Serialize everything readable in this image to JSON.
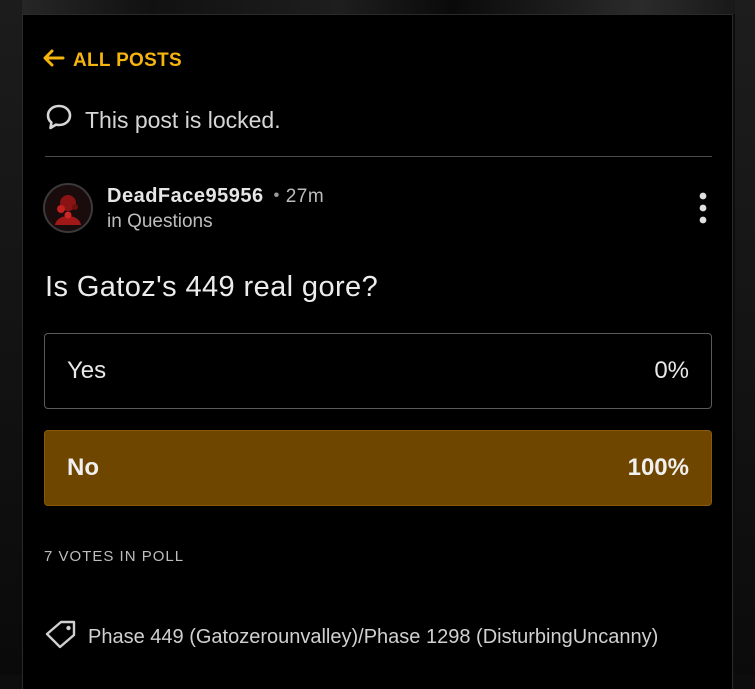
{
  "nav": {
    "back_label": "ALL POSTS"
  },
  "post": {
    "locked_text": "This post is locked.",
    "author": "DeadFace95956",
    "time": "27m",
    "category": "in Questions",
    "question": "Is Gatoz's 449 real gore?"
  },
  "poll": {
    "options": [
      {
        "label": "Yes",
        "percent": "0%"
      },
      {
        "label": "No",
        "percent": "100%"
      }
    ],
    "votes_text": "7 VOTES IN POLL"
  },
  "tags": {
    "text": "Phase 449 (Gatozerounvalley)/Phase 1298 (DisturbingUncanny)"
  },
  "colors": {
    "accent": "#f6b40e",
    "selected_option": "#6e4600"
  },
  "icons": [
    "arrow-left-icon",
    "speech-bubble-icon",
    "more-vertical-icon",
    "tag-icon"
  ]
}
